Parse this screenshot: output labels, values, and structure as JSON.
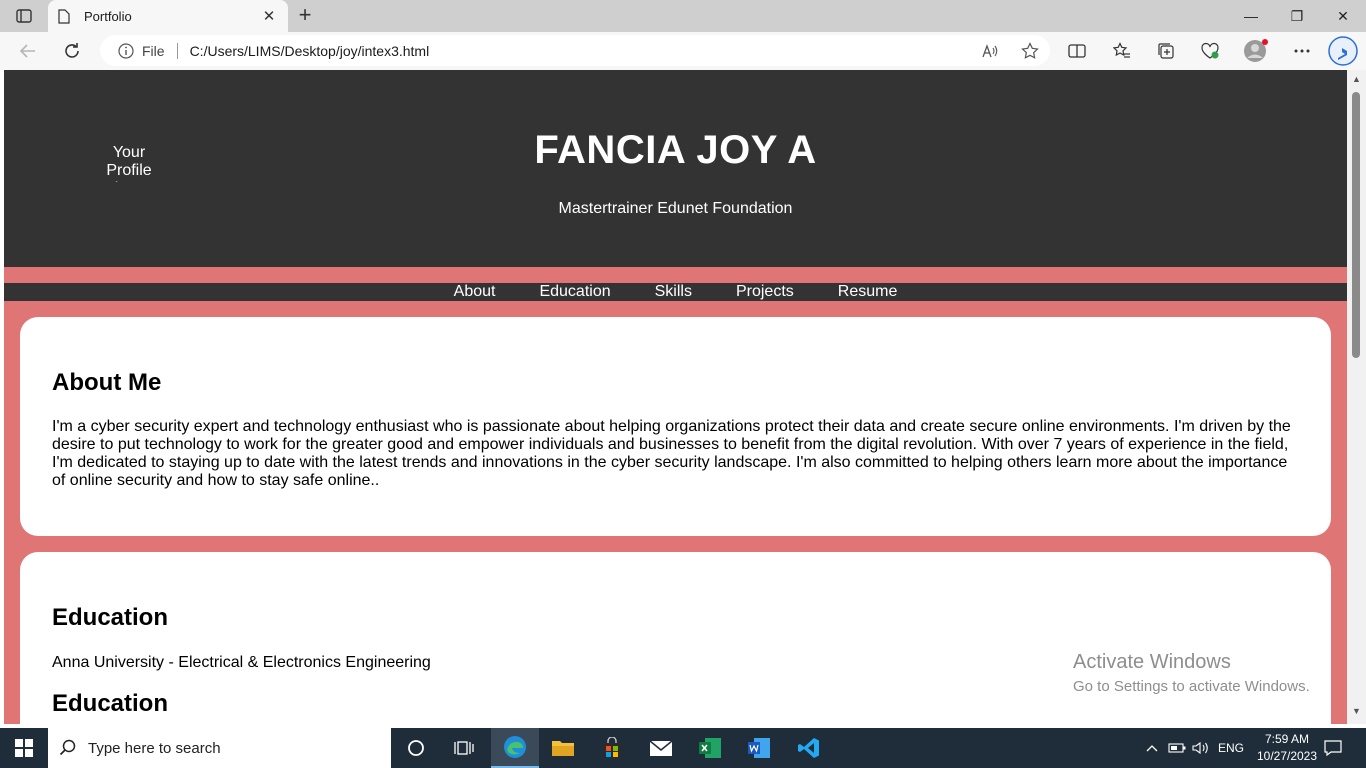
{
  "browser": {
    "tab_title": "Portfolio",
    "tab_close": "✕",
    "new_tab": "+",
    "address": {
      "scheme_label": "File",
      "url": "C:/Users/LIMS/Desktop/joy/intex3.html"
    },
    "window_controls": {
      "minimize": "—",
      "restore": "❐",
      "close": "✕"
    }
  },
  "page": {
    "header": {
      "profile_alt": "Your Profile Picture",
      "title": "FANCIA JOY A",
      "subtitle": "Mastertrainer Edunet Foundation"
    },
    "nav": [
      "About",
      "Education",
      "Skills",
      "Projects",
      "Resume"
    ],
    "about": {
      "heading": "About Me",
      "text": "I'm a cyber security expert and technology enthusiast who is passionate about helping organizations protect their data and create secure online environments. I'm driven by the desire to put technology to work for the greater good and empower individuals and businesses to benefit from the digital revolution. With over 7 years of experience in the field, I'm dedicated to staying up to date with the latest trends and innovations in the cyber security landscape. I'm also committed to helping others learn more about the importance of online security and how to stay safe online.."
    },
    "education": {
      "heading": "Education",
      "entry": "Anna University - Electrical & Electronics Engineering",
      "heading_2": "Education"
    }
  },
  "watermark": {
    "line1": "Activate Windows",
    "line2": "Go to Settings to activate Windows."
  },
  "taskbar": {
    "search_placeholder": "Type here to search",
    "language": "ENG",
    "time": "7:59 AM",
    "date": "10/27/2023"
  },
  "colors": {
    "header_bg": "#333333",
    "page_bg": "#e07575",
    "card_bg": "#ffffff",
    "taskbar_bg": "#1f2d3a"
  }
}
